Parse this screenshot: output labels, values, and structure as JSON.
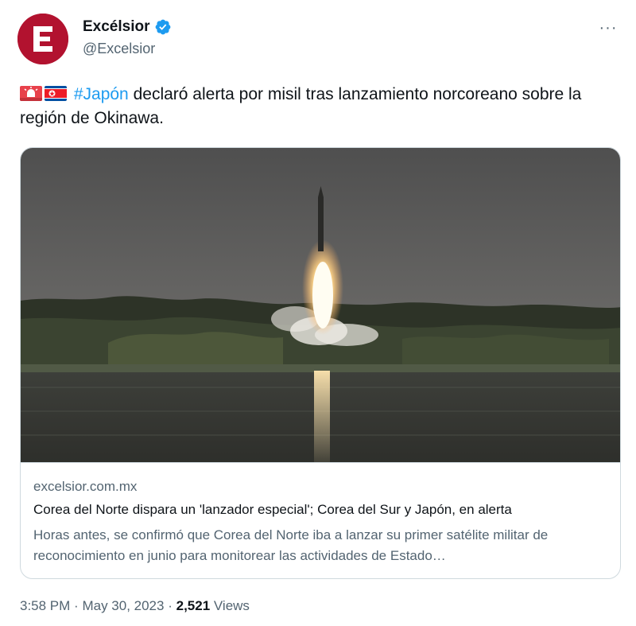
{
  "author": {
    "display_name": "Excélsior",
    "handle": "@Excelsior",
    "avatar_letter": "E",
    "brand_color": "#b2122f",
    "verified_color": "#1d9bf0"
  },
  "tweet": {
    "emojis": [
      "rotating-light-icon",
      "north-korea-flag-icon"
    ],
    "hashtag": "#Japón",
    "text": " declaró alerta por misil tras lanzamiento norcoreano sobre la región de Okinawa."
  },
  "card": {
    "domain": "excelsior.com.mx",
    "title": "Corea del Norte dispara un 'lanzador especial'; Corea del Sur y Japón, en alerta",
    "description": "Horas antes, se confirmó que Corea del Norte iba a lanzar su primer satélite militar de reconocimiento en junio para monitorear las actividades de Estado…"
  },
  "meta": {
    "time": "3:58 PM",
    "separator": "·",
    "date": "May 30, 2023",
    "views_count": "2,521",
    "views_label": "Views"
  },
  "colors": {
    "text_primary": "#0f1419",
    "text_secondary": "#536471",
    "link": "#1d9bf0",
    "border": "#cfd9de"
  }
}
